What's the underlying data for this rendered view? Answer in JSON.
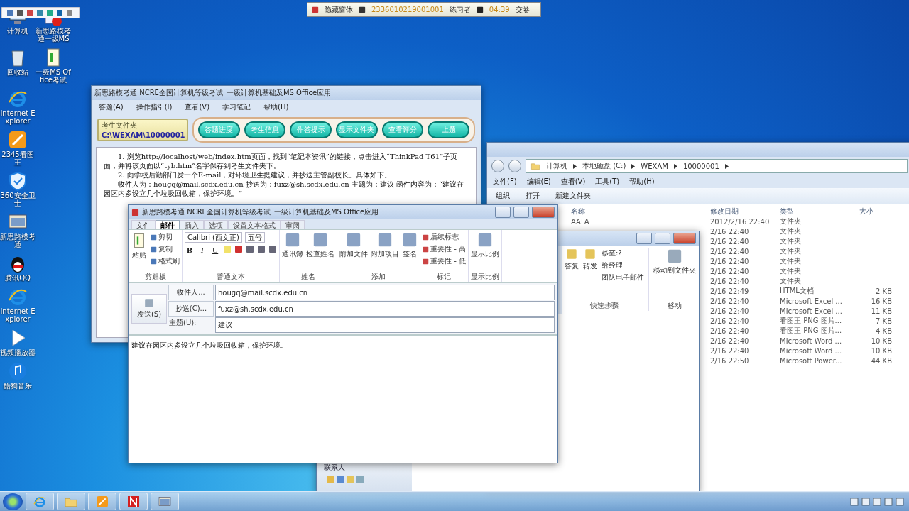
{
  "floating_toolbar": {
    "kind": "pen-tools"
  },
  "exam_bar": {
    "hide_label": "隐藏窗体",
    "ticket": "2336010219001001",
    "user": "练习者",
    "time": "04:39",
    "submit": "交卷"
  },
  "desktop_icons": [
    {
      "label": "计算机",
      "kind": "computer"
    },
    {
      "label": "新思路模考通一级MS",
      "kind": "red-app"
    },
    {
      "label": "回收站",
      "kind": "recycle"
    },
    {
      "label": "一级MS Office考试",
      "kind": "doc"
    },
    {
      "label": "Internet Explorer",
      "kind": "ie"
    },
    {
      "label": "2345看图王",
      "kind": "orange-app"
    },
    {
      "label": "360安全卫士",
      "kind": "shield"
    },
    {
      "label": "新思路模考通",
      "kind": "window-app"
    },
    {
      "label": "腾讯QQ",
      "kind": "penguin"
    },
    {
      "label": "Internet Explorer",
      "kind": "ie"
    },
    {
      "label": "视频播放器",
      "kind": "player"
    },
    {
      "label": "酷狗音乐",
      "kind": "music"
    }
  ],
  "exam_window": {
    "title": "新思路模考通 NCRE全国计算机等级考试_一级计算机基础及MS Office应用",
    "menu": [
      "答题(A)",
      "操作指引(I)",
      "查看(V)",
      "学习笔记",
      "帮助(H)"
    ],
    "folder_caption": "考生文件夹",
    "folder_path": "C:\\WEXAM\\10000001",
    "buttons": [
      "答题进度",
      "考生信息",
      "作答提示",
      "显示文件夹",
      "查看评分",
      "上题"
    ],
    "paragraphs": [
      "1. 浏览http://localhost/web/index.htm页面，找到“笔记本资讯”的链接，点击进入“ThinkPad T61”子页面，并将该页面以“tyb.htm”名字保存到考生文件夹下。",
      "2. 向学校后勤部门发一个E-mail，对环境卫生提建议，并抄送主管副校长。具体如下。",
      "收件人为：hougq@mail.scdx.edu.cn  抄送为：fuxz@sh.scdx.edu.cn  主题为：建议  函件内容为：“建议在园区内多设立几个垃圾回收箱，保护环境。”"
    ]
  },
  "explorer_window": {
    "breadcrumbs": [
      "计算机",
      "本地磁盘 (C:)",
      "WEXAM",
      "10000001"
    ],
    "menu": [
      "文件(F)",
      "编辑(E)",
      "查看(V)",
      "工具(T)",
      "帮助(H)"
    ],
    "toolbar": [
      "组织",
      "打开",
      "新建文件夹"
    ],
    "columns": [
      "名称",
      "修改日期",
      "类型",
      "大小"
    ],
    "rows": [
      {
        "name": "AAFA",
        "date": "2012/2/16 22:40",
        "type": "文件夹"
      },
      {
        "date": "2/16 22:40",
        "type": "文件夹"
      },
      {
        "date": "2/16 22:40",
        "type": "文件夹"
      },
      {
        "date": "2/16 22:40",
        "type": "文件夹"
      },
      {
        "date": "2/16 22:40",
        "type": "文件夹"
      },
      {
        "date": "2/16 22:40",
        "type": "文件夹"
      },
      {
        "date": "2/16 22:40",
        "type": "文件夹"
      },
      {
        "date": "2/16 22:49",
        "type": "HTML文档",
        "size": "2 KB"
      },
      {
        "date": "2/16 22:40",
        "type": "Microsoft Excel ...",
        "size": "16 KB"
      },
      {
        "date": "2/16 22:40",
        "type": "Microsoft Excel ...",
        "size": "11 KB"
      },
      {
        "date": "2/16 22:40",
        "type": "看图王 PNG 图片...",
        "size": "7 KB"
      },
      {
        "date": "2/16 22:40",
        "type": "看图王 PNG 图片...",
        "size": "4 KB"
      },
      {
        "date": "2/16 22:40",
        "type": "Microsoft Word ...",
        "size": "10 KB"
      },
      {
        "date": "2/16 22:40",
        "type": "Microsoft Word ...",
        "size": "10 KB"
      },
      {
        "date": "2/16 22:50",
        "type": "Microsoft Power...",
        "size": "44 KB"
      }
    ]
  },
  "outlook_window": {
    "buttons": [
      "答复",
      "转发"
    ],
    "quick_steps": [
      "移至:?",
      "给经理",
      "团队电子邮件"
    ],
    "move_button": "移动到文件夹",
    "group_labels": [
      "快速步骤",
      "移动"
    ],
    "nav_label": "联系人"
  },
  "mail_window": {
    "title": "新思路模考通 NCRE全国计算机等级考试_一级计算机基础及MS Office应用",
    "tabs": [
      {
        "label": "文件",
        "selected": false
      },
      {
        "label": "邮件",
        "selected": true
      },
      {
        "label": "插入",
        "selected": false
      },
      {
        "label": "选项",
        "selected": false
      },
      {
        "label": "设置文本格式",
        "selected": false
      },
      {
        "label": "审阅",
        "selected": false
      }
    ],
    "ribbon_groups": [
      {
        "kind": "clipboard",
        "label": "剪贴板",
        "large": "粘贴",
        "small": [
          "剪切",
          "复制",
          "格式刷"
        ]
      },
      {
        "kind": "font",
        "label": "普通文本",
        "font_name": "Calibri (西文正)",
        "font_size": "五号",
        "format_buttons": [
          "B",
          "I",
          "U"
        ]
      },
      {
        "kind": "large",
        "label": "姓名",
        "large": [
          "通讯簿",
          "检查姓名"
        ]
      },
      {
        "kind": "large",
        "label": "添加",
        "large": [
          "附加文件",
          "附加项目",
          "签名"
        ]
      },
      {
        "kind": "small",
        "label": "标记",
        "small": [
          "后续标志",
          "重要性 - 高",
          "重要性 - 低"
        ]
      },
      {
        "kind": "large",
        "label": "显示比例",
        "large": [
          "显示比例"
        ]
      }
    ],
    "send_label": "发送(S)",
    "fields": [
      {
        "kind": "button",
        "label": "收件人...",
        "value": "hougq@mail.scdx.edu.cn"
      },
      {
        "kind": "button",
        "label": "抄送(C)...",
        "value": "fuxz@sh.scdx.edu.cn"
      },
      {
        "kind": "plain",
        "label": "主题(U):",
        "value": "建议"
      }
    ],
    "body": "建议在园区内多设立几个垃圾回收箱，保护环境。"
  },
  "taskbar": {
    "apps": [
      {
        "kind": "ie"
      },
      {
        "kind": "folder"
      },
      {
        "kind": "orange-app"
      },
      {
        "kind": "n-app"
      },
      {
        "kind": "window-app"
      }
    ]
  }
}
